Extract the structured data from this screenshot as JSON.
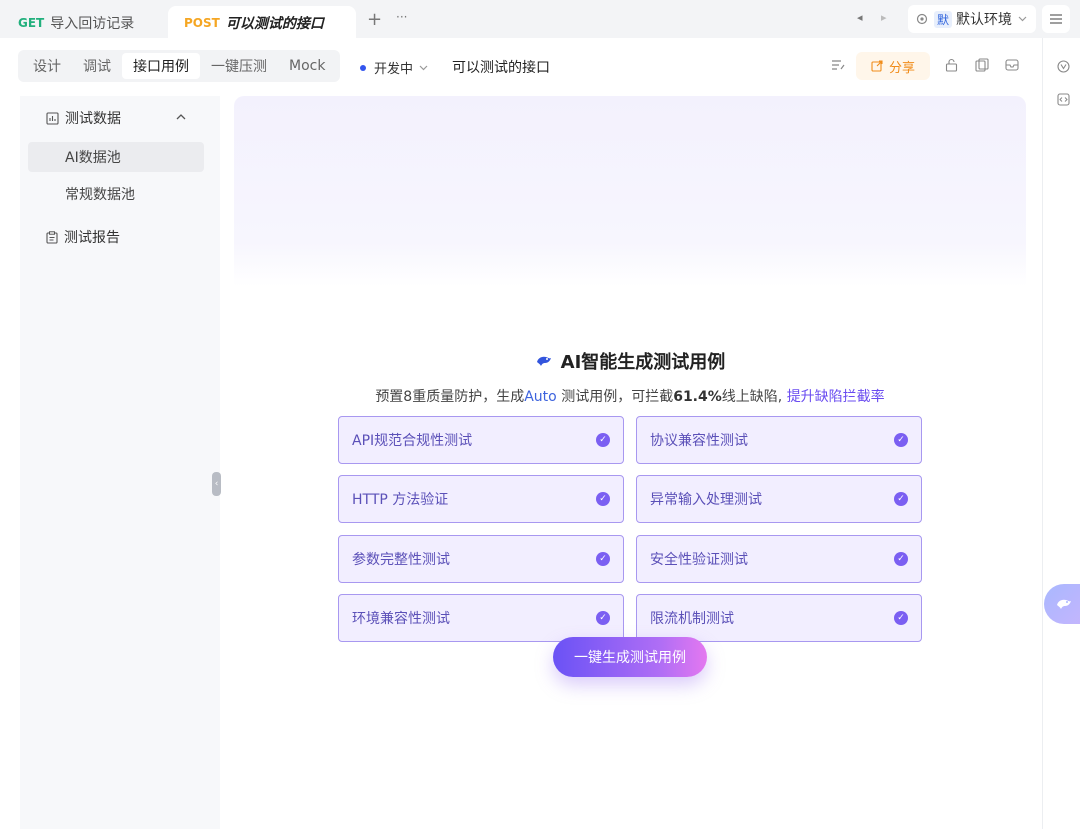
{
  "tabs": [
    {
      "method": "GET",
      "name": "导入回访记录"
    },
    {
      "method": "POST",
      "name": "可以测试的接口"
    }
  ],
  "tabbar_icons": {
    "add": "+",
    "more": "···",
    "prev": "◂",
    "next": "▸"
  },
  "environment": {
    "badge": "默",
    "name": "默认环境"
  },
  "segments": [
    "设计",
    "调试",
    "接口用例",
    "一键压测",
    "Mock"
  ],
  "status": "开发中",
  "api_name": "可以测试的接口",
  "share_label": "分享",
  "sidebar": {
    "groups": [
      {
        "label": "测试数据",
        "children": [
          "AI数据池",
          "常规数据池"
        ]
      },
      {
        "label": "测试报告"
      }
    ]
  },
  "ai": {
    "title": "AI智能生成测试用例",
    "subtitle": {
      "part1": "预置8重质量防护，生成",
      "auto": "Auto",
      "part2": " 测试用例，可拦截",
      "pct": "61.4%",
      "part3": "线上缺陷, ",
      "link": "提升缺陷拦截率"
    },
    "features": [
      "API规范合规性测试",
      "协议兼容性测试",
      "HTTP 方法验证",
      "异常输入处理测试",
      "参数完整性测试",
      "安全性验证测试",
      "环境兼容性测试",
      "限流机制测试"
    ],
    "generate_button": "一键生成测试用例"
  },
  "colors": {
    "accent": "#7b5ff2",
    "brand_blue": "#3355dd",
    "share_orange": "#f08c1a"
  }
}
